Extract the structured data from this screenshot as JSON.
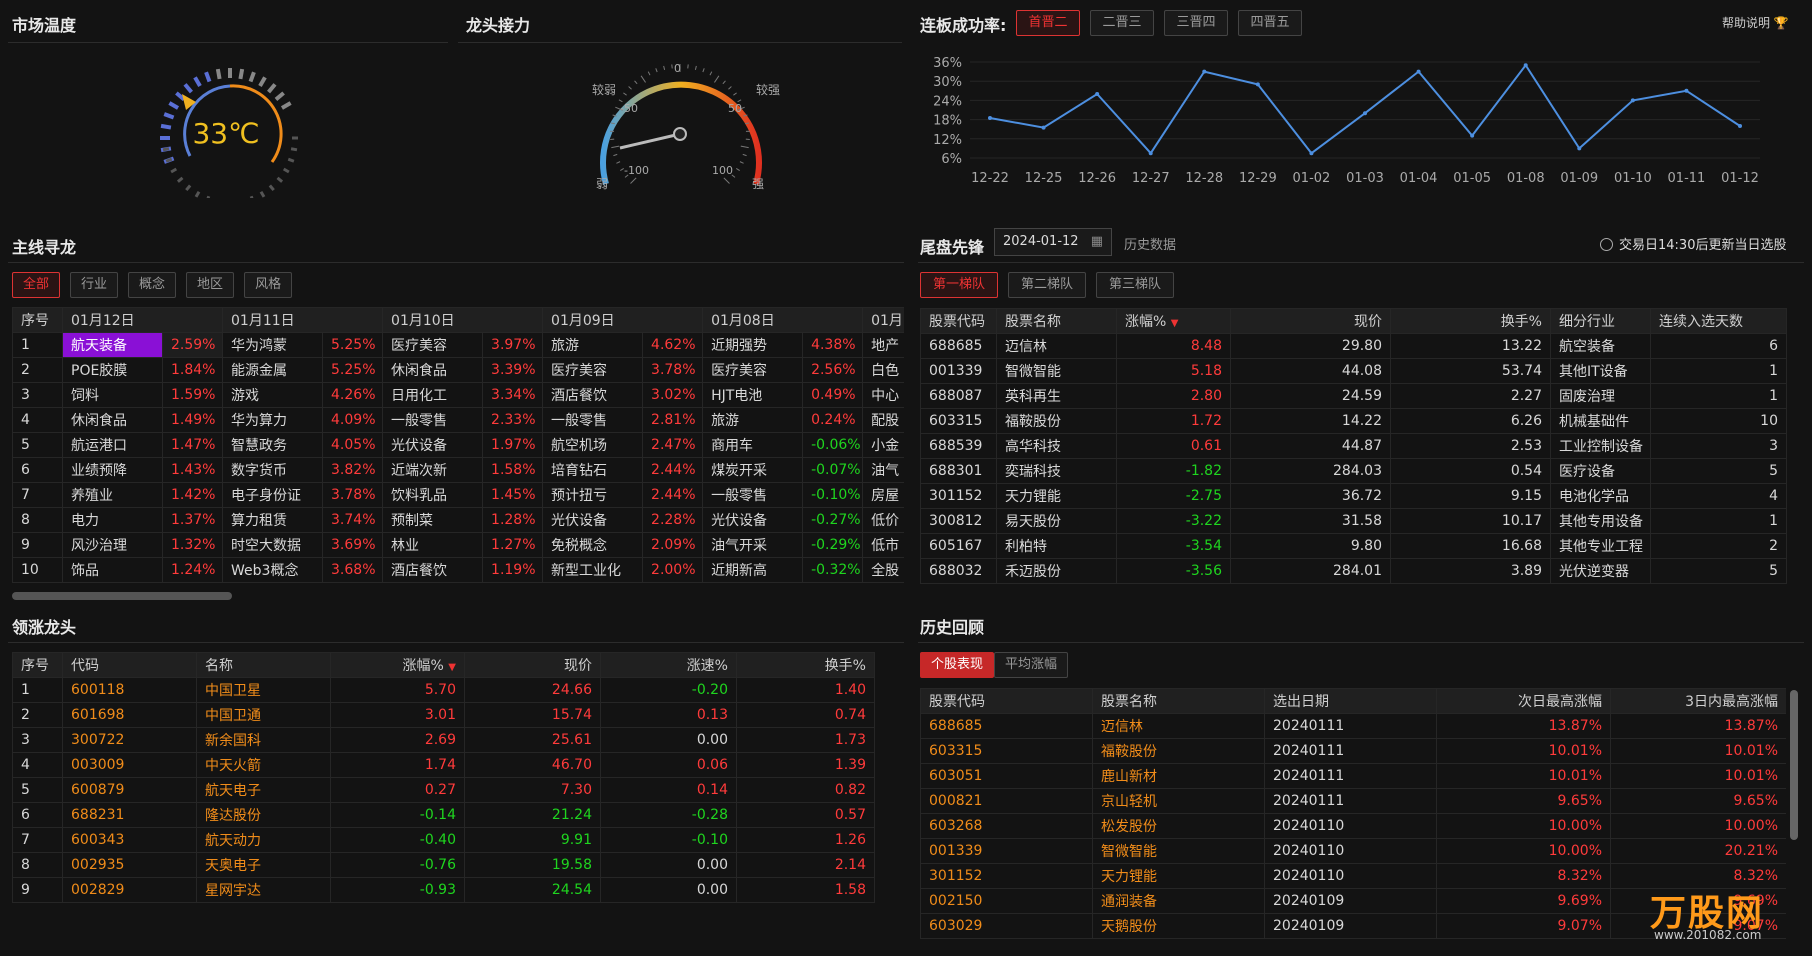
{
  "market_temp": {
    "title": "市场温度",
    "value": "33℃"
  },
  "leader_relay": {
    "title": "龙头接力",
    "labels": {
      "weak": "较弱",
      "strong": "较强",
      "t_m50": "-50",
      "t_0": "0",
      "t_50": "50",
      "t_m100": "-100",
      "t_100": "100",
      "ruo": "弱",
      "qiang": "强"
    }
  },
  "board_success": {
    "title": "连板成功率:",
    "tabs": [
      "首晋二",
      "二晋三",
      "三晋四",
      "四晋五"
    ],
    "help": "帮助说明",
    "chart_data": {
      "type": "line",
      "categories": [
        "12-22",
        "12-25",
        "12-26",
        "12-27",
        "12-28",
        "12-29",
        "01-02",
        "01-03",
        "01-04",
        "01-05",
        "01-08",
        "01-09",
        "01-10",
        "01-11",
        "01-12"
      ],
      "yticks": [
        "36%",
        "30%",
        "24%",
        "18%",
        "12%",
        "6%"
      ],
      "ylim": [
        6,
        36
      ],
      "values": [
        18.5,
        15.5,
        26,
        7.5,
        33,
        29,
        7.5,
        20,
        33,
        13,
        35,
        9,
        24,
        27,
        16
      ]
    }
  },
  "main_line": {
    "title": "主线寻龙",
    "tabs": [
      "全部",
      "行业",
      "概念",
      "地区",
      "风格"
    ],
    "head_seq": "序号",
    "dates": [
      "01月12日",
      "01月11日",
      "01月10日",
      "01月09日",
      "01月08日",
      "01月"
    ],
    "rows": [
      [
        "1",
        "航天装备",
        "2.59%",
        "华为鸿蒙",
        "5.25%",
        "医疗美容",
        "3.97%",
        "旅游",
        "4.62%",
        "近期强势",
        "4.38%",
        "地产"
      ],
      [
        "2",
        "POE胶膜",
        "1.84%",
        "能源金属",
        "5.25%",
        "休闲食品",
        "3.39%",
        "医疗美容",
        "3.78%",
        "医疗美容",
        "2.56%",
        "白色"
      ],
      [
        "3",
        "饲料",
        "1.59%",
        "游戏",
        "4.26%",
        "日用化工",
        "3.34%",
        "酒店餐饮",
        "3.02%",
        "HJT电池",
        "0.49%",
        "中心"
      ],
      [
        "4",
        "休闲食品",
        "1.49%",
        "华为算力",
        "4.09%",
        "一般零售",
        "2.33%",
        "一般零售",
        "2.81%",
        "旅游",
        "0.24%",
        "配股"
      ],
      [
        "5",
        "航运港口",
        "1.47%",
        "智慧政务",
        "4.05%",
        "光伏设备",
        "1.97%",
        "航空机场",
        "2.47%",
        "商用车",
        "-0.06%",
        "小金"
      ],
      [
        "6",
        "业绩预降",
        "1.43%",
        "数字货币",
        "3.82%",
        "近端次新",
        "1.58%",
        "培育钻石",
        "2.44%",
        "煤炭开采",
        "-0.07%",
        "油气"
      ],
      [
        "7",
        "养殖业",
        "1.42%",
        "电子身份证",
        "3.78%",
        "饮料乳品",
        "1.45%",
        "预计扭亏",
        "2.44%",
        "一般零售",
        "-0.10%",
        "房屋"
      ],
      [
        "8",
        "电力",
        "1.37%",
        "算力租赁",
        "3.74%",
        "预制菜",
        "1.28%",
        "光伏设备",
        "2.28%",
        "光伏设备",
        "-0.27%",
        "低价"
      ],
      [
        "9",
        "风沙治理",
        "1.32%",
        "时空大数据",
        "3.69%",
        "林业",
        "1.27%",
        "免税概念",
        "2.09%",
        "油气开采",
        "-0.29%",
        "低市"
      ],
      [
        "10",
        "饰品",
        "1.24%",
        "Web3概念",
        "3.68%",
        "酒店餐饮",
        "1.19%",
        "新型工业化",
        "2.00%",
        "近期新高",
        "-0.32%",
        "全股"
      ]
    ]
  },
  "tail": {
    "title": "尾盘先锋",
    "date": "2024-01-12",
    "history": "历史数据",
    "note": "交易日14:30后更新当日选股",
    "tabs": [
      "第一梯队",
      "第二梯队",
      "第三梯队"
    ],
    "headers": [
      "股票代码",
      "股票名称",
      "涨幅%",
      "现价",
      "换手%",
      "细分行业",
      "连续入选天数"
    ],
    "rows": [
      [
        "688685",
        "迈信林",
        "8.48",
        "29.80",
        "13.22",
        "航空装备",
        "6"
      ],
      [
        "001339",
        "智微智能",
        "5.18",
        "44.08",
        "53.74",
        "其他IT设备",
        "1"
      ],
      [
        "688087",
        "英科再生",
        "2.80",
        "24.59",
        "2.27",
        "固废治理",
        "1"
      ],
      [
        "603315",
        "福鞍股份",
        "1.72",
        "14.22",
        "6.26",
        "机械基础件",
        "10"
      ],
      [
        "688539",
        "高华科技",
        "0.61",
        "44.87",
        "2.53",
        "工业控制设备",
        "3"
      ],
      [
        "688301",
        "奕瑞科技",
        "-1.82",
        "284.03",
        "0.54",
        "医疗设备",
        "5"
      ],
      [
        "301152",
        "天力锂能",
        "-2.75",
        "36.72",
        "9.15",
        "电池化学品",
        "4"
      ],
      [
        "300812",
        "易天股份",
        "-3.22",
        "31.58",
        "10.17",
        "其他专用设备",
        "1"
      ],
      [
        "605167",
        "利柏特",
        "-3.54",
        "9.80",
        "16.68",
        "其他专业工程",
        "2"
      ],
      [
        "688032",
        "禾迈股份",
        "-3.56",
        "284.01",
        "3.89",
        "光伏逆变器",
        "5"
      ]
    ]
  },
  "leaders": {
    "title": "领涨龙头",
    "headers": [
      "序号",
      "代码",
      "名称",
      "涨幅%",
      "现价",
      "涨速%",
      "换手%"
    ],
    "rows": [
      [
        "1",
        "600118",
        "中国卫星",
        "5.70",
        "24.66",
        "-0.20",
        "1.40"
      ],
      [
        "2",
        "601698",
        "中国卫通",
        "3.01",
        "15.74",
        "0.13",
        "0.74"
      ],
      [
        "3",
        "300722",
        "新余国科",
        "2.69",
        "25.61",
        "0.00",
        "1.73"
      ],
      [
        "4",
        "003009",
        "中天火箭",
        "1.74",
        "46.70",
        "0.06",
        "1.39"
      ],
      [
        "5",
        "600879",
        "航天电子",
        "0.27",
        "7.30",
        "0.14",
        "0.82"
      ],
      [
        "6",
        "688231",
        "隆达股份",
        "-0.14",
        "21.24",
        "-0.28",
        "0.57"
      ],
      [
        "7",
        "600343",
        "航天动力",
        "-0.40",
        "9.91",
        "-0.10",
        "1.26"
      ],
      [
        "8",
        "002935",
        "天奥电子",
        "-0.76",
        "19.58",
        "0.00",
        "2.14"
      ],
      [
        "9",
        "002829",
        "星网宇达",
        "-0.93",
        "24.54",
        "0.00",
        "1.58"
      ]
    ]
  },
  "history": {
    "title": "历史回顾",
    "tabs": [
      "个股表现",
      "平均涨幅"
    ],
    "headers": [
      "股票代码",
      "股票名称",
      "选出日期",
      "次日最高涨幅",
      "3日内最高涨幅"
    ],
    "rows": [
      [
        "688685",
        "迈信林",
        "20240111",
        "13.87%",
        "13.87%"
      ],
      [
        "603315",
        "福鞍股份",
        "20240111",
        "10.01%",
        "10.01%"
      ],
      [
        "603051",
        "鹿山新材",
        "20240111",
        "10.01%",
        "10.01%"
      ],
      [
        "000821",
        "京山轻机",
        "20240111",
        "9.65%",
        "9.65%"
      ],
      [
        "603268",
        "松发股份",
        "20240110",
        "10.00%",
        "10.00%"
      ],
      [
        "001339",
        "智微智能",
        "20240110",
        "10.00%",
        "20.21%"
      ],
      [
        "301152",
        "天力锂能",
        "20240110",
        "8.32%",
        "8.32%"
      ],
      [
        "002150",
        "通润装备",
        "20240109",
        "9.69%",
        "9.69%"
      ],
      [
        "603029",
        "天鹅股份",
        "20240109",
        "9.07%",
        "9.07%"
      ]
    ]
  },
  "logo": {
    "text": "万股网",
    "url": "www.201082.com"
  },
  "colors": {
    "up": "#ff3b3b",
    "down": "#1fd51f",
    "accent": "#c62828",
    "line": "#4d8fe0",
    "highlight": "#8a10d6"
  }
}
